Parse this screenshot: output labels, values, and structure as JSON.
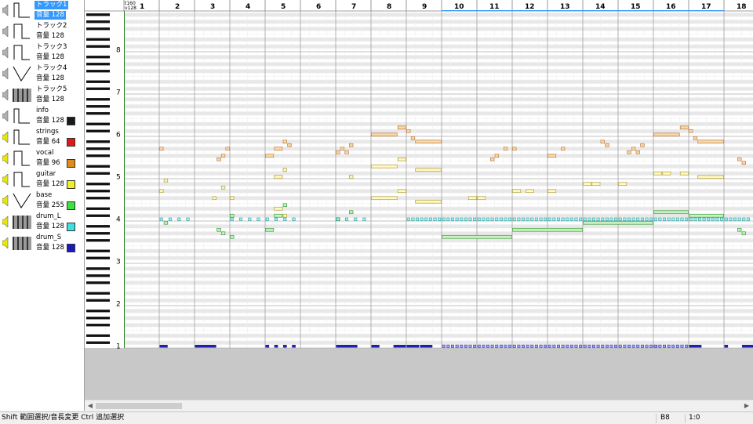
{
  "tracks": [
    {
      "name": "トラック1",
      "volume_label": "音量 128",
      "wave": "pulse25",
      "selected": true,
      "speaker": "gray",
      "color": null
    },
    {
      "name": "トラック2",
      "volume_label": "音量 128",
      "wave": "pulse50",
      "selected": false,
      "speaker": "gray",
      "color": null
    },
    {
      "name": "トラック3",
      "volume_label": "音量 128",
      "wave": "pulse50",
      "selected": false,
      "speaker": "gray",
      "color": null
    },
    {
      "name": "トラック4",
      "volume_label": "音量 128",
      "wave": "triangle",
      "selected": false,
      "speaker": "gray",
      "color": null
    },
    {
      "name": "トラック5",
      "volume_label": "音量 128",
      "wave": "noise",
      "selected": false,
      "speaker": "gray",
      "color": null
    },
    {
      "name": "info",
      "volume_label": "音量 128",
      "wave": "pulse25",
      "selected": false,
      "speaker": "gray",
      "color": "#1a1a1a"
    },
    {
      "name": "strings",
      "volume_label": "音量 64",
      "wave": "pulse25",
      "selected": false,
      "speaker": "yellow",
      "color": "#e01818"
    },
    {
      "name": "vocal",
      "volume_label": "音量 96",
      "wave": "pulse50",
      "selected": false,
      "speaker": "yellow",
      "color": "#e08a1e"
    },
    {
      "name": "guitar",
      "volume_label": "音量 128",
      "wave": "pulse50",
      "selected": false,
      "speaker": "yellow",
      "color": "#f0f020"
    },
    {
      "name": "base",
      "volume_label": "音量 255",
      "wave": "triangle",
      "selected": false,
      "speaker": "yellow",
      "color": "#40e040"
    },
    {
      "name": "drum_L",
      "volume_label": "音量 128",
      "wave": "noise",
      "selected": false,
      "speaker": "yellow",
      "color": "#40e0e0"
    },
    {
      "name": "drum_S",
      "volume_label": "音量 128",
      "wave": "noise",
      "selected": false,
      "speaker": "yellow",
      "color": "#1a1ac0"
    }
  ],
  "ruler": {
    "tempo_label": "t160",
    "volume_label": "v128",
    "measures": [
      "1",
      "2",
      "3",
      "4",
      "5",
      "6",
      "7",
      "8",
      "9",
      "10",
      "11",
      "12",
      "13",
      "14",
      "15",
      "16",
      "17",
      "18"
    ]
  },
  "octave_labels": [
    {
      "label": "8",
      "octave": 8
    },
    {
      "label": "7",
      "octave": 7
    },
    {
      "label": "6",
      "octave": 6
    },
    {
      "label": "5",
      "octave": 5
    },
    {
      "label": "4",
      "octave": 4
    },
    {
      "label": "3",
      "octave": 3
    },
    {
      "label": "2",
      "octave": 2
    },
    {
      "label": "1",
      "octave": 1
    }
  ],
  "notes": {
    "vocal": [
      {
        "m": 2,
        "b": 0,
        "len": 0.5,
        "p": 56
      },
      {
        "m": 3,
        "b": 2.5,
        "len": 0.5,
        "p": 53
      },
      {
        "m": 3,
        "b": 3,
        "len": 0.5,
        "p": 54
      },
      {
        "m": 3,
        "b": 3.5,
        "len": 0.5,
        "p": 56
      },
      {
        "m": 5,
        "b": 0,
        "len": 1,
        "p": 54
      },
      {
        "m": 5,
        "b": 1,
        "len": 1,
        "p": 56
      },
      {
        "m": 5,
        "b": 2,
        "len": 0.5,
        "p": 58
      },
      {
        "m": 5,
        "b": 2.5,
        "len": 0.5,
        "p": 57
      },
      {
        "m": 7,
        "b": 0,
        "len": 0.5,
        "p": 55
      },
      {
        "m": 7,
        "b": 0.5,
        "len": 0.5,
        "p": 56
      },
      {
        "m": 7,
        "b": 1,
        "len": 0.5,
        "p": 55
      },
      {
        "m": 7,
        "b": 1.5,
        "len": 0.5,
        "p": 57
      },
      {
        "m": 8,
        "b": 0,
        "len": 3,
        "p": 60
      },
      {
        "m": 8,
        "b": 3,
        "len": 1,
        "p": 62
      },
      {
        "m": 9,
        "b": 0,
        "len": 0.5,
        "p": 61
      },
      {
        "m": 9,
        "b": 0.5,
        "len": 0.5,
        "p": 59
      },
      {
        "m": 9,
        "b": 1,
        "len": 3,
        "p": 58
      },
      {
        "m": 11,
        "b": 3,
        "len": 0.5,
        "p": 56
      },
      {
        "m": 12,
        "b": 0,
        "len": 0.5,
        "p": 56
      },
      {
        "m": 11,
        "b": 1.5,
        "len": 0.5,
        "p": 53
      },
      {
        "m": 11,
        "b": 2,
        "len": 0.5,
        "p": 54
      },
      {
        "m": 13,
        "b": 0,
        "len": 1,
        "p": 54
      },
      {
        "m": 13,
        "b": 1.5,
        "len": 0.5,
        "p": 56
      },
      {
        "m": 14,
        "b": 2,
        "len": 0.5,
        "p": 58
      },
      {
        "m": 14,
        "b": 2.5,
        "len": 0.5,
        "p": 57
      },
      {
        "m": 15,
        "b": 1,
        "len": 0.5,
        "p": 55
      },
      {
        "m": 15,
        "b": 1.5,
        "len": 0.5,
        "p": 56
      },
      {
        "m": 15,
        "b": 2,
        "len": 0.5,
        "p": 55
      },
      {
        "m": 15,
        "b": 2.5,
        "len": 0.5,
        "p": 57
      },
      {
        "m": 16,
        "b": 0,
        "len": 3,
        "p": 60
      },
      {
        "m": 16,
        "b": 3,
        "len": 1,
        "p": 62
      },
      {
        "m": 17,
        "b": 0,
        "len": 0.5,
        "p": 61
      },
      {
        "m": 17,
        "b": 0.5,
        "len": 0.5,
        "p": 59
      },
      {
        "m": 17,
        "b": 1,
        "len": 3,
        "p": 58
      },
      {
        "m": 18,
        "b": 1.5,
        "len": 0.5,
        "p": 53
      },
      {
        "m": 18,
        "b": 2,
        "len": 0.5,
        "p": 52
      }
    ],
    "guitar": [
      {
        "m": 5,
        "b": 1,
        "len": 1,
        "p": 48
      },
      {
        "m": 5,
        "b": 2,
        "len": 0.5,
        "p": 50
      },
      {
        "m": 7,
        "b": 1.5,
        "len": 0.5,
        "p": 48
      },
      {
        "m": 8,
        "b": 0,
        "len": 3,
        "p": 51
      },
      {
        "m": 8,
        "b": 3,
        "len": 1,
        "p": 53
      },
      {
        "m": 9,
        "b": 1,
        "len": 3,
        "p": 50
      },
      {
        "m": 16,
        "b": 0,
        "len": 1,
        "p": 49
      },
      {
        "m": 16,
        "b": 1,
        "len": 1,
        "p": 49
      },
      {
        "m": 16,
        "b": 3,
        "len": 1,
        "p": 49
      },
      {
        "m": 17,
        "b": 1,
        "len": 3,
        "p": 48
      }
    ],
    "guitar2": [
      {
        "m": 2,
        "b": 0.5,
        "len": 0.5,
        "p": 47
      },
      {
        "m": 2,
        "b": 0,
        "len": 0.5,
        "p": 44
      },
      {
        "m": 3,
        "b": 3,
        "len": 0.5,
        "p": 45
      },
      {
        "m": 3,
        "b": 2,
        "len": 0.5,
        "p": 42
      },
      {
        "m": 4,
        "b": 0,
        "len": 0.5,
        "p": 42
      },
      {
        "m": 5,
        "b": 1,
        "len": 1,
        "p": 39
      },
      {
        "m": 5,
        "b": 2,
        "len": 0.5,
        "p": 37
      },
      {
        "m": 8,
        "b": 0,
        "len": 3,
        "p": 42
      },
      {
        "m": 8,
        "b": 3,
        "len": 1,
        "p": 44
      },
      {
        "m": 9,
        "b": 1,
        "len": 3,
        "p": 41
      },
      {
        "m": 10,
        "b": 3,
        "len": 1,
        "p": 42
      },
      {
        "m": 11,
        "b": 0,
        "len": 1,
        "p": 42
      },
      {
        "m": 12,
        "b": 0,
        "len": 1,
        "p": 44
      },
      {
        "m": 12,
        "b": 1.5,
        "len": 1,
        "p": 44
      },
      {
        "m": 13,
        "b": 0,
        "len": 1,
        "p": 44
      },
      {
        "m": 14,
        "b": 0,
        "len": 1,
        "p": 46
      },
      {
        "m": 14,
        "b": 1,
        "len": 1,
        "p": 46
      },
      {
        "m": 15,
        "b": 0,
        "len": 1,
        "p": 46
      }
    ],
    "strings_green": [
      {
        "m": 2,
        "b": 0.5,
        "len": 0.5,
        "p": 35
      },
      {
        "m": 4,
        "b": 0,
        "len": 0.5,
        "p": 37
      },
      {
        "m": 5,
        "b": 1,
        "len": 1,
        "p": 37
      },
      {
        "m": 5,
        "b": 2,
        "len": 0.5,
        "p": 40
      },
      {
        "m": 7,
        "b": 0,
        "len": 0.5,
        "p": 36
      },
      {
        "m": 7,
        "b": 1.5,
        "len": 0.5,
        "p": 38
      },
      {
        "m": 10,
        "b": 0,
        "len": 8,
        "p": 31
      },
      {
        "m": 12,
        "b": 0,
        "len": 8,
        "p": 33
      },
      {
        "m": 14,
        "b": 0,
        "len": 8,
        "p": 35
      },
      {
        "m": 16,
        "b": 0,
        "len": 4,
        "p": 38
      },
      {
        "m": 17,
        "b": 0,
        "len": 4,
        "p": 37
      },
      {
        "m": 18,
        "b": 2,
        "len": 0.5,
        "p": 32
      },
      {
        "m": 18,
        "b": 1.5,
        "len": 0.5,
        "p": 33
      },
      {
        "m": 3,
        "b": 3,
        "len": 0.5,
        "p": 32
      },
      {
        "m": 3,
        "b": 2.5,
        "len": 0.5,
        "p": 33
      },
      {
        "m": 4,
        "b": 0,
        "len": 0.5,
        "p": 31
      },
      {
        "m": 5,
        "b": 0,
        "len": 1,
        "p": 33
      }
    ],
    "drum_S": [
      {
        "m": 2,
        "b": 0,
        "len": 1,
        "p": 1
      },
      {
        "m": 3,
        "b": 0,
        "len": 2.5,
        "p": 1
      },
      {
        "m": 5,
        "b": 0,
        "len": 0.5,
        "p": 1
      },
      {
        "m": 5,
        "b": 1,
        "len": 0.5,
        "p": 1
      },
      {
        "m": 5,
        "b": 2,
        "len": 0.5,
        "p": 1
      },
      {
        "m": 5,
        "b": 3,
        "len": 0.5,
        "p": 1
      },
      {
        "m": 7,
        "b": 0,
        "len": 2.5,
        "p": 1
      },
      {
        "m": 8,
        "b": 0,
        "len": 1,
        "p": 1
      },
      {
        "m": 8,
        "b": 2.5,
        "len": 1.5,
        "p": 1
      },
      {
        "m": 9,
        "b": 0,
        "len": 1.5,
        "p": 1
      },
      {
        "m": 9,
        "b": 1.5,
        "len": 1.5,
        "p": 1
      },
      {
        "m": 16,
        "b": 0,
        "len": 0.5,
        "p": 1
      },
      {
        "m": 17,
        "b": 0,
        "len": 1.5,
        "p": 1
      },
      {
        "m": 18,
        "b": 0,
        "len": 0.5,
        "p": 1
      },
      {
        "m": 18,
        "b": 2,
        "len": 2,
        "p": 1
      }
    ]
  },
  "status": {
    "hint": "Shift 範囲選択/音長変更 Ctrl 追加選択",
    "note": "B8",
    "position": "1:0"
  },
  "colors": {
    "vocal": "#f8d8a8",
    "vocal_border": "#c08040",
    "guitar": "#fff8c0",
    "guitar_border": "#b0a040",
    "strings_green": "#c8f0c0",
    "strings_green_border": "#40a040",
    "drum_L": "#a8f0f0",
    "drum_L_border": "#30a0a0",
    "drum_S": "#2020b0",
    "drum_S_light": "#a0a0f0",
    "grid_line": "#d8d8d8",
    "measure_line": "#a0a0a0",
    "black_key_row": "#e8e8e8"
  }
}
